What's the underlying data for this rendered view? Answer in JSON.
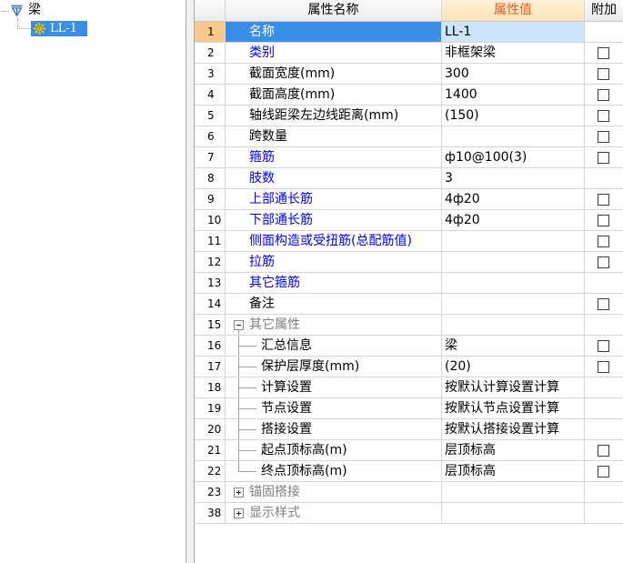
{
  "tree": {
    "root": {
      "label": "梁",
      "icon": "beam-icon"
    },
    "items": [
      {
        "label": "LL-1",
        "icon": "gear-icon",
        "selected": true
      }
    ]
  },
  "grid": {
    "header": {
      "name": "属性名称",
      "value": "属性值",
      "extra": "附加"
    },
    "rows": [
      {
        "num": "1",
        "name": "名称",
        "value": "LL-1",
        "selected": true
      },
      {
        "num": "2",
        "name": "类别",
        "value": "非框架梁",
        "attach": false
      },
      {
        "num": "3",
        "name": "截面宽度(mm)",
        "value": "300",
        "attach": false
      },
      {
        "num": "4",
        "name": "截面高度(mm)",
        "value": "1400",
        "attach": false
      },
      {
        "num": "5",
        "name": "轴线距梁左边线距离(mm)",
        "value": "(150)",
        "attach": false
      },
      {
        "num": "6",
        "name": "跨数量",
        "attach": false
      },
      {
        "num": "7",
        "name": "箍筋",
        "value": "ф10@100(3)",
        "attach": false
      },
      {
        "num": "8",
        "name": "肢数",
        "value": "3"
      },
      {
        "num": "9",
        "name": "上部通长筋",
        "value": "4ф20",
        "attach": false
      },
      {
        "num": "10",
        "name": "下部通长筋",
        "value": "4ф20",
        "attach": false
      },
      {
        "num": "11",
        "name": "侧面构造或受扭筋(总配筋值)",
        "attach": false
      },
      {
        "num": "12",
        "name": "拉筋",
        "attach": false
      },
      {
        "num": "13",
        "name": "其它箍筋"
      },
      {
        "num": "14",
        "name": "备注",
        "attach": false
      },
      {
        "num": "15",
        "name": "其它属性",
        "group": true,
        "expanded": true
      },
      {
        "num": "16",
        "name": "汇总信息",
        "value": "梁",
        "attach": false
      },
      {
        "num": "17",
        "name": "保护层厚度(mm)",
        "value": "(20)",
        "attach": false
      },
      {
        "num": "18",
        "name": "计算设置",
        "value": "按默认计算设置计算"
      },
      {
        "num": "19",
        "name": "节点设置",
        "value": "按默认节点设置计算"
      },
      {
        "num": "20",
        "name": "搭接设置",
        "value": "按默认搭接设置计算"
      },
      {
        "num": "21",
        "name": "起点顶标高(m)",
        "value": "层顶标高",
        "attach": false
      },
      {
        "num": "22",
        "name": "终点顶标高(m)",
        "value": "层顶标高",
        "attach": false
      },
      {
        "num": "23",
        "name": "锚固搭接",
        "group": true,
        "expanded": false
      },
      {
        "num": "38",
        "name": "显示样式",
        "group": true,
        "expanded": false
      }
    ]
  },
  "colors": {
    "selection": "#3a8ee6",
    "selected_value_bg": "#cce5fb",
    "selected_row_number_bg": "#f9c88a",
    "value_header_bg": "#fde3b8",
    "value_header_text": "#e8591a",
    "public_property_text": "#0000ff",
    "group_text": "#808080",
    "gridline": "#d6d6d6"
  }
}
